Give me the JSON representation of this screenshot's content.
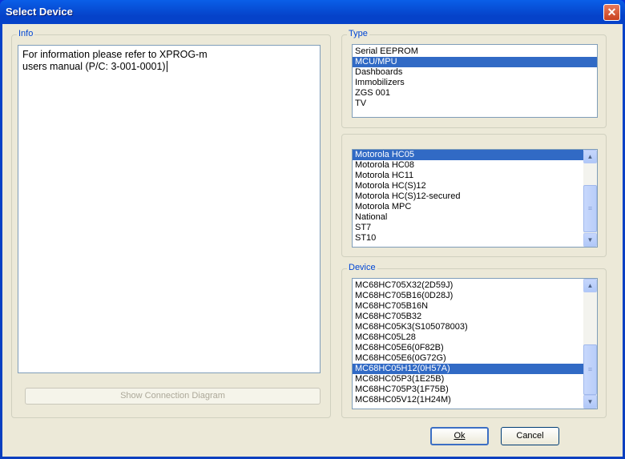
{
  "window": {
    "title": "Select Device",
    "close": "✕"
  },
  "info": {
    "label": "Info",
    "text_lines": [
      "For information please refer to XPROG-m",
      "users manual (P/C: 3-001-0001)"
    ],
    "button": "Show Connection Diagram"
  },
  "type": {
    "label": "Type",
    "items": [
      "Serial EEPROM",
      "MCU/MPU",
      "Dashboards",
      "Immobilizers",
      "ZGS 001",
      "TV"
    ],
    "selected": "MCU/MPU"
  },
  "family": {
    "items": [
      "Motorola HC05",
      "Motorola HC08",
      "Motorola HC11",
      "Motorola HC(S)12",
      "Motorola HC(S)12-secured",
      "Motorola MPC",
      "National",
      "ST7",
      "ST10"
    ],
    "selected": "Motorola HC05"
  },
  "device": {
    "label": "Device",
    "items": [
      "MC68HC705X32(2D59J)",
      "MC68HC705B16(0D28J)",
      "MC68HC705B16N",
      "MC68HC705B32",
      "MC68HC05K3(S105078003)",
      "MC68HC05L28",
      "MC68HC05E6(0F82B)",
      "MC68HC05E6(0G72G)",
      "MC68HC05H12(0H57A)",
      "MC68HC05P3(1E25B)",
      "MC68HC705P3(1F75B)",
      "MC68HC05V12(1H24M)"
    ],
    "selected": "MC68HC05H12(0H57A)"
  },
  "buttons": {
    "ok": "Ok",
    "cancel": "Cancel"
  },
  "colors": {
    "selection": "#316ac5",
    "group_label": "#0046d5",
    "titlebar": "#0542c9"
  }
}
